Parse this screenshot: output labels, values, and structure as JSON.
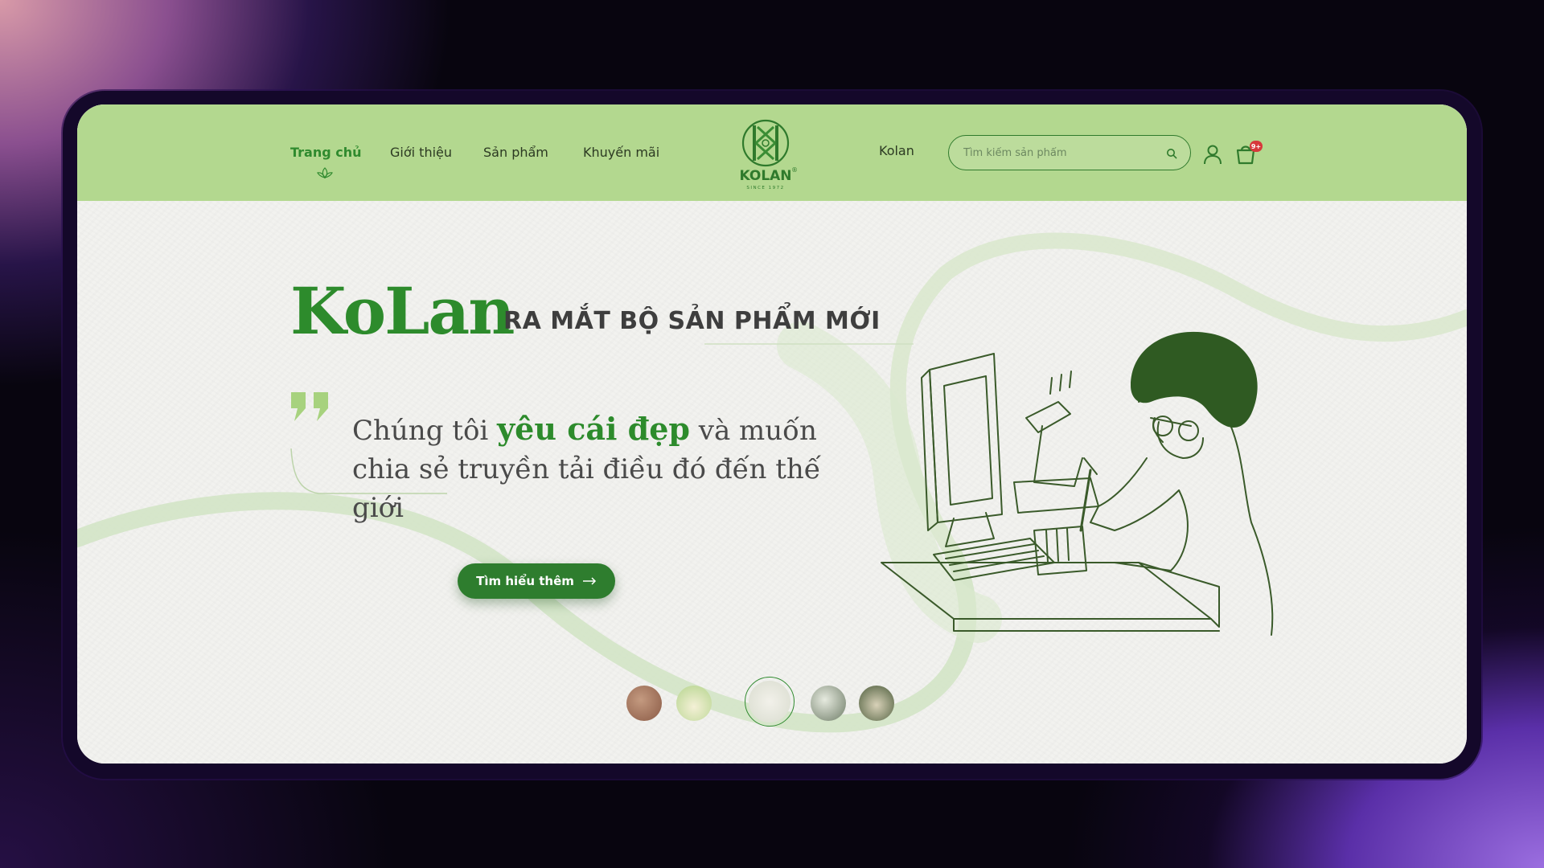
{
  "header": {
    "nav": [
      {
        "label": "Trang chủ",
        "active": true
      },
      {
        "label": "Giới thiệu",
        "active": false
      },
      {
        "label": "Sản phẩm",
        "active": false
      },
      {
        "label": "Khuyến mãi",
        "active": false
      }
    ],
    "logo_text": "KOLAN",
    "logo_since": "SINCE 1972",
    "logo_reg": "®",
    "brand_link": "Kolan",
    "search_placeholder": "Tìm kiếm sản phẩm",
    "cart_badge": "9+",
    "icons": [
      "leaf-icon",
      "search-icon",
      "user-icon",
      "cart-icon"
    ]
  },
  "hero": {
    "brand": "KoLan",
    "tagline": "RA MẮT BỘ SẢN PHẨM MỚI",
    "quote_part1": "Chúng tôi ",
    "quote_highlight": "yêu cái đẹp",
    "quote_part2": " và muốn chia sẻ truyền tải điều đó đến thế giới",
    "cta_label": "Tìm hiểu thêm",
    "cta_icon": "arrow-right-icon"
  },
  "thumbnails": {
    "count": 5,
    "active_index": 2
  },
  "colors": {
    "header_bg": "#b3d88f",
    "accent_green": "#2d8b2c",
    "button_green": "#2e7d2e",
    "badge_red": "#d7383b"
  }
}
